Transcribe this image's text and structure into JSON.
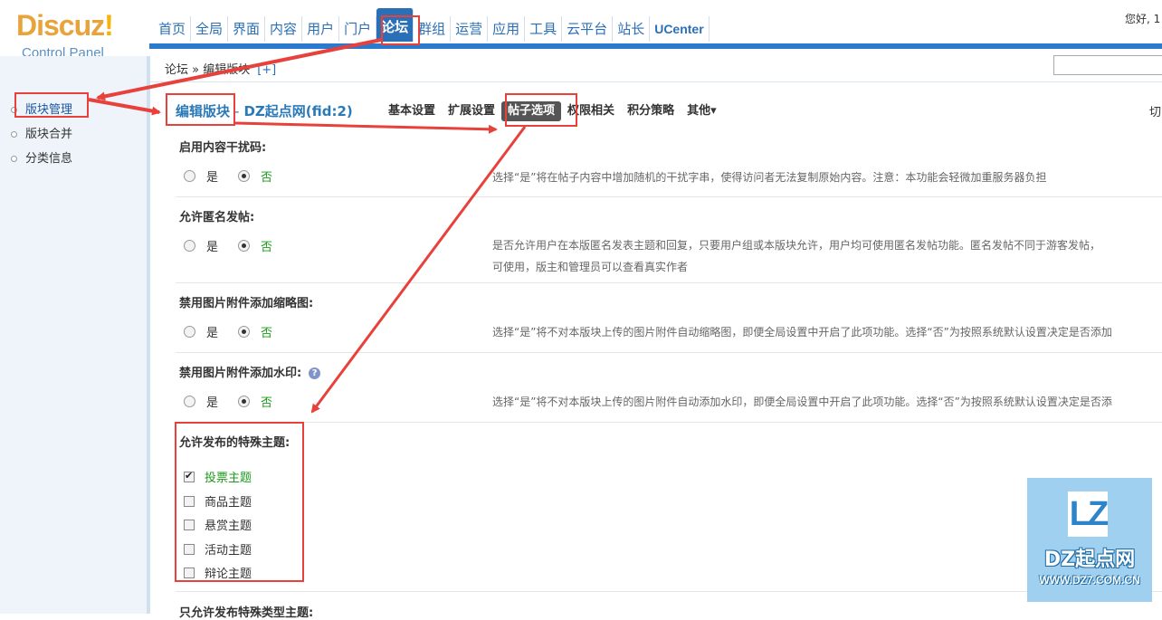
{
  "logo": {
    "title": "Discuz",
    "bang": "!",
    "subtitle": "Control Panel"
  },
  "nav": [
    "首页",
    "全局",
    "界面",
    "内容",
    "用户",
    "门户",
    "论坛",
    "群组",
    "运营",
    "应用",
    "工具",
    "云平台",
    "站长",
    "UCenter"
  ],
  "greeting": "您好, 1",
  "breadcrumb": {
    "text": "论坛 » 编辑版块",
    "plus": "[+]"
  },
  "sidebar": [
    {
      "label": "版块管理"
    },
    {
      "label": "版块合并"
    },
    {
      "label": "分类信息"
    }
  ],
  "page": {
    "title": "编辑版块",
    "sep": "-",
    "forum": "DZ起点网(fid:2)"
  },
  "tabs": [
    "基本设置",
    "扩展设置",
    "帖子选项",
    "权限相关",
    "积分策略",
    "其他▾"
  ],
  "tab_active": "帖子选项",
  "cut_text": "切",
  "radio_yes": "是",
  "radio_no": "否",
  "sections": [
    {
      "label": "启用内容干扰码:",
      "desc": "选择“是”将在帖子内容中增加随机的干扰字串，使得访问者无法复制原始内容。注意：本功能会轻微加重服务器负担"
    },
    {
      "label": "允许匿名发帖:",
      "desc": "是否允许用户在本版匿名发表主题和回复，只要用户组或本版块允许，用户均可使用匿名发帖功能。匿名发帖不同于游客发帖，",
      "desc2": "可使用，版主和管理员可以查看真实作者"
    },
    {
      "label": "禁用图片附件添加缩略图:",
      "desc": "选择“是”将不对本版块上传的图片附件自动缩略图，即便全局设置中开启了此项功能。选择“否”为按照系统默认设置决定是否添加"
    },
    {
      "label": "禁用图片附件添加水印:",
      "desc": "选择“是”将不对本版块上传的图片附件自动添加水印，即便全局设置中开启了此项功能。选择“否”为按照系统默认设置决定是否添"
    }
  ],
  "special": {
    "label": "允许发布的特殊主题:",
    "items": [
      {
        "label": "投票主题",
        "checked": true
      },
      {
        "label": "商品主题",
        "checked": false
      },
      {
        "label": "悬赏主题",
        "checked": false
      },
      {
        "label": "活动主题",
        "checked": false
      },
      {
        "label": "辩论主题",
        "checked": false
      }
    ]
  },
  "last_label": "只允许发布特殊类型主题:",
  "help_glyph": "?",
  "watermark": {
    "logo": "LZ",
    "name": "DZ起点网",
    "url": "WWW.DZ7.COM.CN"
  },
  "colors": {
    "accent": "#2b6fb6",
    "annotation": "#e8403b",
    "green": "#1a9c1a"
  }
}
